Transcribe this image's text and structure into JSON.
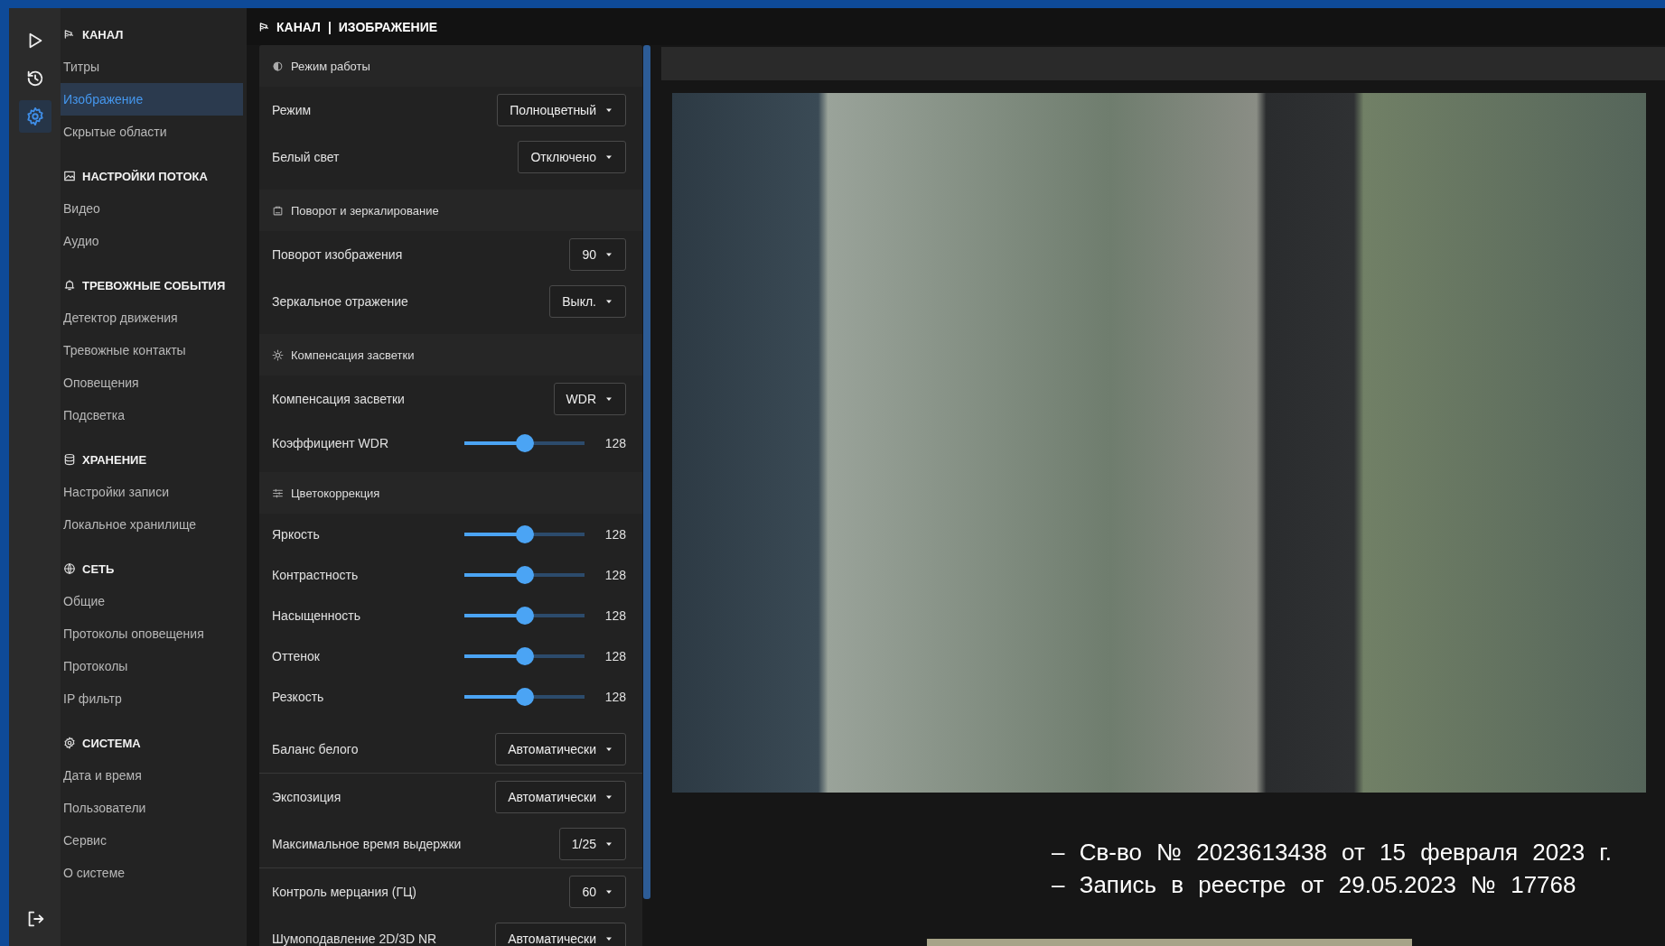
{
  "rail": [
    {
      "selected": false
    },
    {
      "selected": false
    },
    {
      "selected": true
    },
    {
      "selected": false
    }
  ],
  "sidebar": {
    "sections": [
      {
        "title": "КАНАЛ",
        "items": [
          {
            "label": "Титры",
            "selected": false
          },
          {
            "label": "Изображение",
            "selected": true
          },
          {
            "label": "Скрытые области",
            "selected": false
          }
        ]
      },
      {
        "title": "НАСТРОЙКИ ПОТОКА",
        "items": [
          {
            "label": "Видео",
            "selected": false
          },
          {
            "label": "Аудио",
            "selected": false
          }
        ]
      },
      {
        "title": "ТРЕВОЖНЫЕ СОБЫТИЯ",
        "items": [
          {
            "label": "Детектор движения",
            "selected": false
          },
          {
            "label": "Тревожные контакты",
            "selected": false
          },
          {
            "label": "Оповещения",
            "selected": false
          },
          {
            "label": "Подсветка",
            "selected": false
          }
        ]
      },
      {
        "title": "ХРАНЕНИЕ",
        "items": [
          {
            "label": "Настройки записи",
            "selected": false
          },
          {
            "label": "Локальное хранилище",
            "selected": false
          }
        ]
      },
      {
        "title": "СЕТЬ",
        "items": [
          {
            "label": "Общие",
            "selected": false
          },
          {
            "label": "Протоколы оповещения",
            "selected": false
          },
          {
            "label": "Протоколы",
            "selected": false
          },
          {
            "label": "IP фильтр",
            "selected": false
          }
        ]
      },
      {
        "title": "СИСТЕМА",
        "items": [
          {
            "label": "Дата и время",
            "selected": false
          },
          {
            "label": "Пользователи",
            "selected": false
          },
          {
            "label": "Сервис",
            "selected": false
          },
          {
            "label": "О системе",
            "selected": false
          }
        ]
      }
    ]
  },
  "breadcrumb": {
    "items": [
      "КАНАЛ",
      "ИЗОБРАЖЕНИЕ"
    ],
    "separator": "|"
  },
  "settings": [
    {
      "title": "Режим работы",
      "rows": [
        {
          "kind": "select",
          "label": "Режим",
          "value": "Полноцветный"
        },
        {
          "kind": "select",
          "label": "Белый свет",
          "value": "Отключено"
        }
      ]
    },
    {
      "title": "Поворот и зеркалирование",
      "rows": [
        {
          "kind": "select",
          "label": "Поворот изображения",
          "value": "90"
        },
        {
          "kind": "select",
          "label": "Зеркальное отражение",
          "value": "Выкл."
        }
      ]
    },
    {
      "title": "Компенсация засветки",
      "rows": [
        {
          "kind": "select",
          "label": "Компенсация засветки",
          "value": "WDR"
        },
        {
          "kind": "slider",
          "label": "Коэффициент WDR",
          "level": 0.5,
          "reading": "128"
        }
      ]
    },
    {
      "title": "Цветокоррекция",
      "rows": [
        {
          "kind": "slider",
          "label": "Яркость",
          "level": 0.5,
          "reading": "128"
        },
        {
          "kind": "slider",
          "label": "Контрастность",
          "level": 0.5,
          "reading": "128"
        },
        {
          "kind": "slider",
          "label": "Насыщенность",
          "level": 0.5,
          "reading": "128"
        },
        {
          "kind": "slider",
          "label": "Оттенок",
          "level": 0.5,
          "reading": "128"
        },
        {
          "kind": "slider",
          "label": "Резкость",
          "level": 0.5,
          "reading": "128"
        }
      ]
    },
    {
      "rows": [
        {
          "kind": "select",
          "label": "Баланс белого",
          "value": "Автоматически"
        }
      ]
    },
    {
      "rows": [
        {
          "kind": "select",
          "label": "Экспозиция",
          "value": "Автоматически"
        },
        {
          "kind": "select",
          "label": "Максимальное время выдержки",
          "value": "1/25"
        }
      ]
    },
    {
      "rows": [
        {
          "kind": "select",
          "label": "Контроль мерцания (ГЦ)",
          "value": "60"
        },
        {
          "kind": "select",
          "label": "Шумоподавление 2D/3D NR",
          "value": "Автоматически"
        }
      ]
    }
  ],
  "caption_lines": [
    "– Св-во № 2023613438 от 15 февраля 2023 г.",
    "– Запись в реестре от 29.05.2023 № 17768"
  ]
}
